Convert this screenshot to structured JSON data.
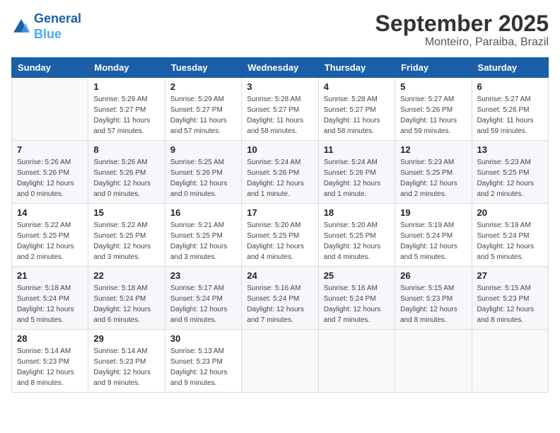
{
  "header": {
    "logo_line1": "General",
    "logo_line2": "Blue",
    "month": "September 2025",
    "location": "Monteiro, Paraiba, Brazil"
  },
  "weekdays": [
    "Sunday",
    "Monday",
    "Tuesday",
    "Wednesday",
    "Thursday",
    "Friday",
    "Saturday"
  ],
  "weeks": [
    [
      {
        "day": "",
        "info": ""
      },
      {
        "day": "1",
        "info": "Sunrise: 5:29 AM\nSunset: 5:27 PM\nDaylight: 11 hours\nand 57 minutes."
      },
      {
        "day": "2",
        "info": "Sunrise: 5:29 AM\nSunset: 5:27 PM\nDaylight: 11 hours\nand 57 minutes."
      },
      {
        "day": "3",
        "info": "Sunrise: 5:28 AM\nSunset: 5:27 PM\nDaylight: 11 hours\nand 58 minutes."
      },
      {
        "day": "4",
        "info": "Sunrise: 5:28 AM\nSunset: 5:27 PM\nDaylight: 11 hours\nand 58 minutes."
      },
      {
        "day": "5",
        "info": "Sunrise: 5:27 AM\nSunset: 5:26 PM\nDaylight: 11 hours\nand 59 minutes."
      },
      {
        "day": "6",
        "info": "Sunrise: 5:27 AM\nSunset: 5:26 PM\nDaylight: 11 hours\nand 59 minutes."
      }
    ],
    [
      {
        "day": "7",
        "info": "Sunrise: 5:26 AM\nSunset: 5:26 PM\nDaylight: 12 hours\nand 0 minutes."
      },
      {
        "day": "8",
        "info": "Sunrise: 5:26 AM\nSunset: 5:26 PM\nDaylight: 12 hours\nand 0 minutes."
      },
      {
        "day": "9",
        "info": "Sunrise: 5:25 AM\nSunset: 5:26 PM\nDaylight: 12 hours\nand 0 minutes."
      },
      {
        "day": "10",
        "info": "Sunrise: 5:24 AM\nSunset: 5:26 PM\nDaylight: 12 hours\nand 1 minute."
      },
      {
        "day": "11",
        "info": "Sunrise: 5:24 AM\nSunset: 5:26 PM\nDaylight: 12 hours\nand 1 minute."
      },
      {
        "day": "12",
        "info": "Sunrise: 5:23 AM\nSunset: 5:25 PM\nDaylight: 12 hours\nand 2 minutes."
      },
      {
        "day": "13",
        "info": "Sunrise: 5:23 AM\nSunset: 5:25 PM\nDaylight: 12 hours\nand 2 minutes."
      }
    ],
    [
      {
        "day": "14",
        "info": "Sunrise: 5:22 AM\nSunset: 5:25 PM\nDaylight: 12 hours\nand 2 minutes."
      },
      {
        "day": "15",
        "info": "Sunrise: 5:22 AM\nSunset: 5:25 PM\nDaylight: 12 hours\nand 3 minutes."
      },
      {
        "day": "16",
        "info": "Sunrise: 5:21 AM\nSunset: 5:25 PM\nDaylight: 12 hours\nand 3 minutes."
      },
      {
        "day": "17",
        "info": "Sunrise: 5:20 AM\nSunset: 5:25 PM\nDaylight: 12 hours\nand 4 minutes."
      },
      {
        "day": "18",
        "info": "Sunrise: 5:20 AM\nSunset: 5:25 PM\nDaylight: 12 hours\nand 4 minutes."
      },
      {
        "day": "19",
        "info": "Sunrise: 5:19 AM\nSunset: 5:24 PM\nDaylight: 12 hours\nand 5 minutes."
      },
      {
        "day": "20",
        "info": "Sunrise: 5:19 AM\nSunset: 5:24 PM\nDaylight: 12 hours\nand 5 minutes."
      }
    ],
    [
      {
        "day": "21",
        "info": "Sunrise: 5:18 AM\nSunset: 5:24 PM\nDaylight: 12 hours\nand 5 minutes."
      },
      {
        "day": "22",
        "info": "Sunrise: 5:18 AM\nSunset: 5:24 PM\nDaylight: 12 hours\nand 6 minutes."
      },
      {
        "day": "23",
        "info": "Sunrise: 5:17 AM\nSunset: 5:24 PM\nDaylight: 12 hours\nand 6 minutes."
      },
      {
        "day": "24",
        "info": "Sunrise: 5:16 AM\nSunset: 5:24 PM\nDaylight: 12 hours\nand 7 minutes."
      },
      {
        "day": "25",
        "info": "Sunrise: 5:16 AM\nSunset: 5:24 PM\nDaylight: 12 hours\nand 7 minutes."
      },
      {
        "day": "26",
        "info": "Sunrise: 5:15 AM\nSunset: 5:23 PM\nDaylight: 12 hours\nand 8 minutes."
      },
      {
        "day": "27",
        "info": "Sunrise: 5:15 AM\nSunset: 5:23 PM\nDaylight: 12 hours\nand 8 minutes."
      }
    ],
    [
      {
        "day": "28",
        "info": "Sunrise: 5:14 AM\nSunset: 5:23 PM\nDaylight: 12 hours\nand 8 minutes."
      },
      {
        "day": "29",
        "info": "Sunrise: 5:14 AM\nSunset: 5:23 PM\nDaylight: 12 hours\nand 9 minutes."
      },
      {
        "day": "30",
        "info": "Sunrise: 5:13 AM\nSunset: 5:23 PM\nDaylight: 12 hours\nand 9 minutes."
      },
      {
        "day": "",
        "info": ""
      },
      {
        "day": "",
        "info": ""
      },
      {
        "day": "",
        "info": ""
      },
      {
        "day": "",
        "info": ""
      }
    ]
  ]
}
